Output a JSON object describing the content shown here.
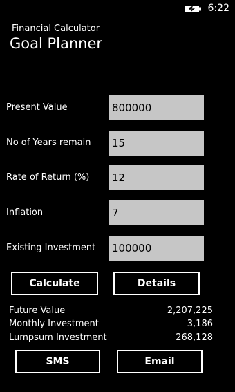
{
  "status_bar": {
    "time": "6:22",
    "battery_icon": "battery-charging-icon"
  },
  "header": {
    "app_title": "Financial Calculator",
    "page_title": "Goal Planner"
  },
  "form": {
    "present_value": {
      "label": "Present Value",
      "value": "800000"
    },
    "years_remain": {
      "label": "No of Years remain",
      "value": "15"
    },
    "rate_of_return": {
      "label": "Rate of Return (%)",
      "value": "12"
    },
    "inflation": {
      "label": "Inflation",
      "value": "7"
    },
    "existing_investment": {
      "label": "Existing Investment",
      "value": "100000"
    }
  },
  "actions": {
    "calculate_label": "Calculate",
    "details_label": "Details",
    "sms_label": "SMS",
    "email_label": "Email"
  },
  "results": {
    "future_value": {
      "label": "Future Value",
      "value": "2,207,225"
    },
    "monthly_investment": {
      "label": "Monthly Investment",
      "value": "3,186"
    },
    "lumpsum_investment": {
      "label": "Lumpsum Investment",
      "value": "268,128"
    }
  },
  "colors": {
    "background": "#000000",
    "input_background": "#c6c6c6",
    "text": "#ffffff"
  }
}
